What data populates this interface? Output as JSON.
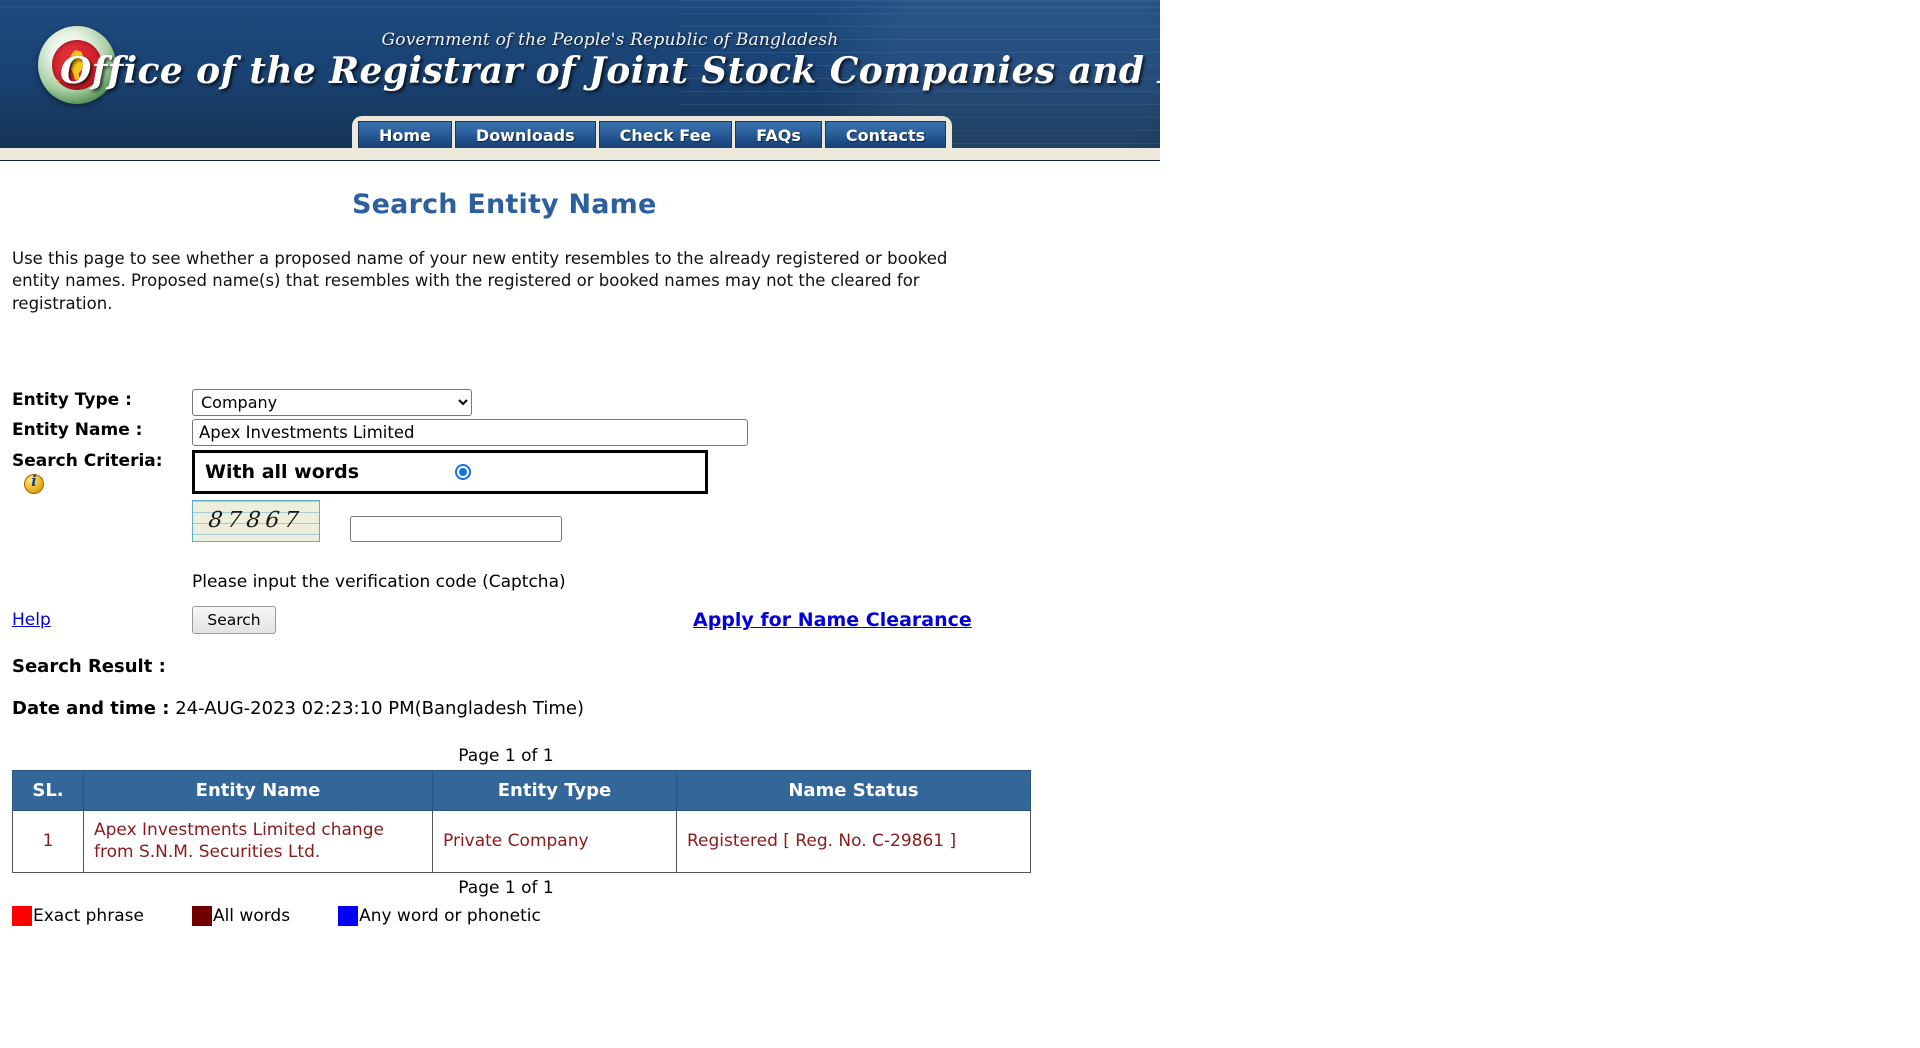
{
  "banner": {
    "subtitle": "Government of the People's Republic of Bangladesh",
    "title": "Office of the Registrar of Joint Stock Companies and Firms",
    "seal_name": "bangladesh-government-seal"
  },
  "nav": {
    "items": [
      {
        "label": "Home"
      },
      {
        "label": "Downloads"
      },
      {
        "label": "Check Fee"
      },
      {
        "label": "FAQs"
      },
      {
        "label": "Contacts"
      }
    ]
  },
  "page": {
    "title": "Search Entity Name",
    "intro": "Use this page to see whether a proposed name of your new entity resembles to the already registered or booked entity names. Proposed name(s) that resembles with the registered or booked names may not the cleared for registration."
  },
  "form": {
    "entity_type_label": "Entity Type :",
    "entity_type_value": "Company",
    "entity_type_options": [
      "Company"
    ],
    "entity_name_label": "Entity Name :",
    "entity_name_value": "Apex Investments Limited",
    "entity_name_placeholder": "",
    "search_criteria_label": "Search Criteria:",
    "search_criteria_selected": "With all words",
    "info_icon": "info-icon",
    "captcha_code": "87867",
    "captcha_input_value": "",
    "captcha_input_placeholder": "",
    "captcha_hint": "Please input the verification code (Captcha)",
    "help_label": "Help",
    "search_label": "Search",
    "clearance_label": "Apply for Name Clearance"
  },
  "results": {
    "result_label": "Search Result  :",
    "datetime_label": "Date and time  :",
    "datetime_value": "24-AUG-2023 02:23:10 PM(Bangladesh Time)",
    "page_indicator": "Page 1 of 1",
    "columns": [
      "SL.",
      "Entity Name",
      "Entity Type",
      "Name Status"
    ],
    "rows": [
      {
        "sl": "1",
        "entity_name": "Apex Investments Limited change from S.N.M. Securities Ltd.",
        "entity_type": "Private Company",
        "name_status": "Registered [ Reg. No. C-29861 ]"
      }
    ]
  },
  "legend": {
    "items": [
      {
        "label": "Exact phrase",
        "color": "#ff0000"
      },
      {
        "label": "All words",
        "color": "#700000"
      },
      {
        "label": "Any word or phonetic",
        "color": "#0000ff"
      }
    ]
  },
  "colors": {
    "banner_blue": "#1a4274",
    "title_blue": "#2c5f9e",
    "table_header": "#336699",
    "result_text": "#8b1a1a",
    "link_blue": "#0000dd"
  }
}
